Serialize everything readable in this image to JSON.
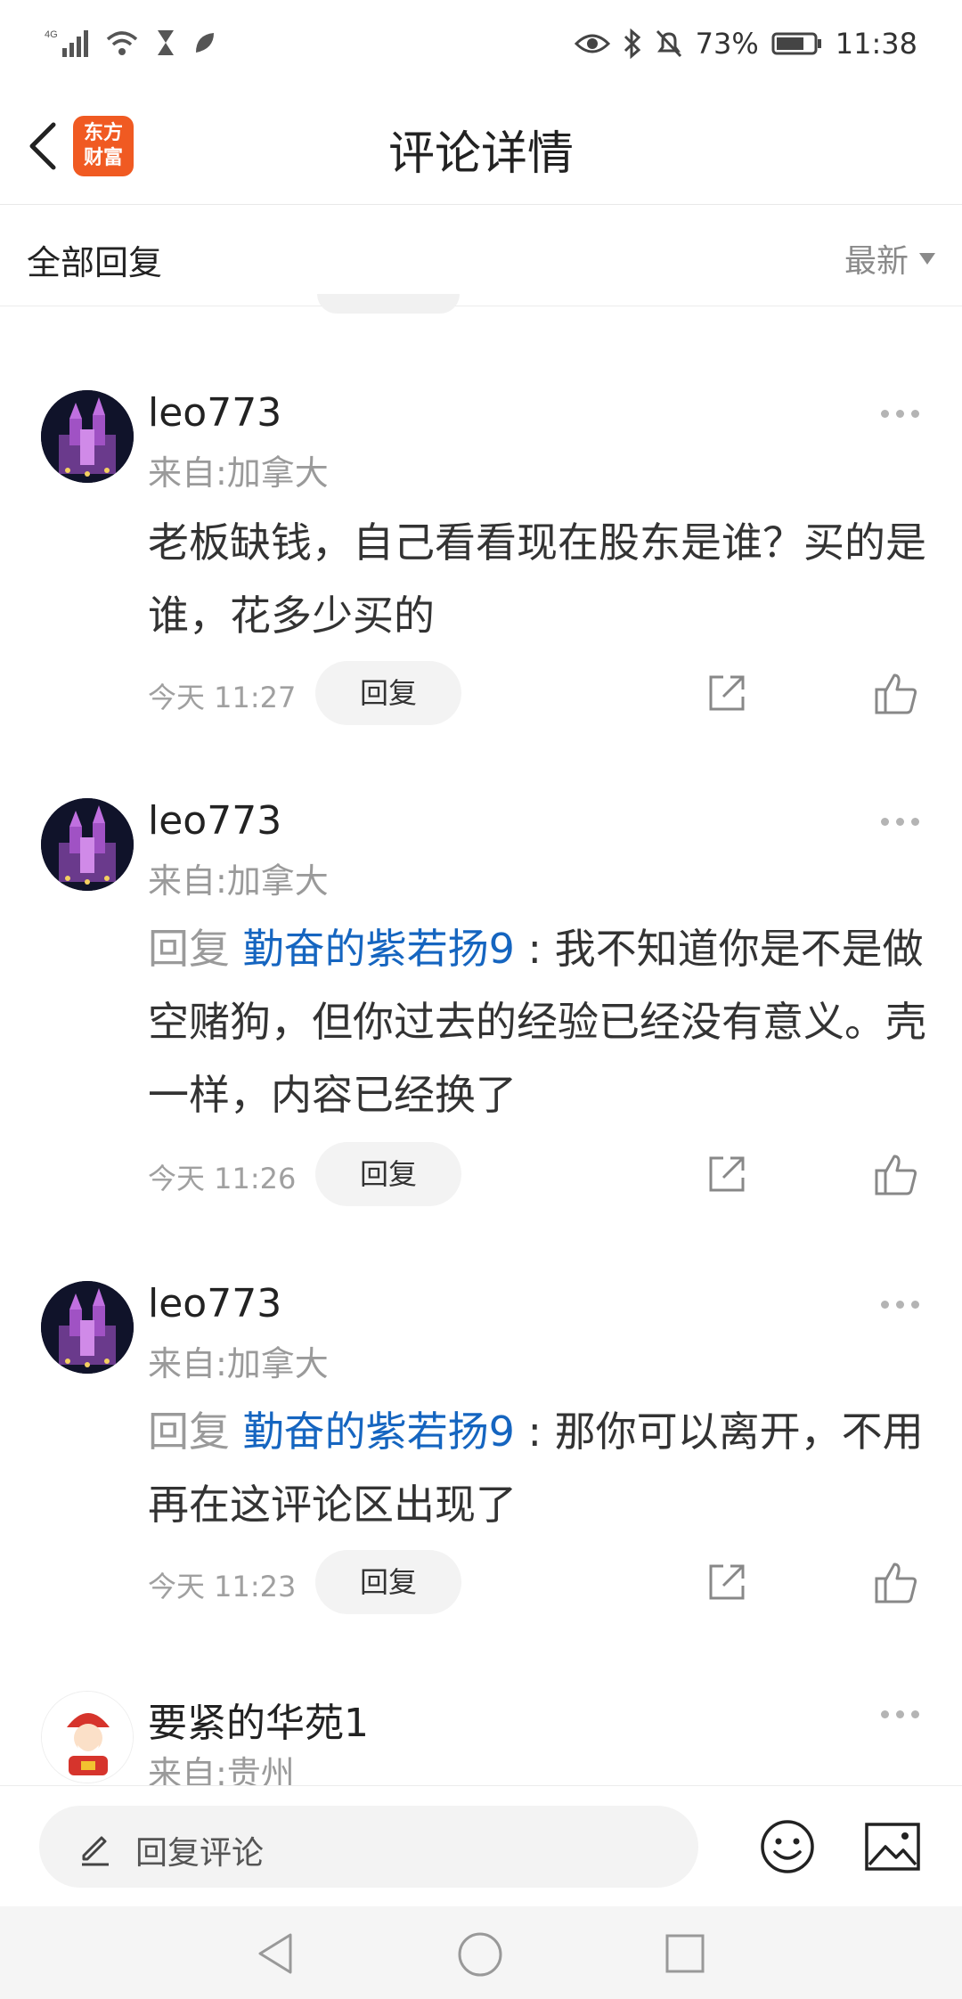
{
  "status_bar": {
    "network": "4G",
    "battery": "73%",
    "time": "11:38"
  },
  "header": {
    "title": "评论详情",
    "logo_text": "东方财富"
  },
  "subbar": {
    "all_replies": "全部回复",
    "sort": "最新"
  },
  "comments": [
    {
      "user": "leo773",
      "location": "来自:加拿大",
      "reply_prefix": "",
      "mention": "",
      "text": "老板缺钱，自己看看现在股东是谁？买的是谁，花多少买的",
      "time": "今天 11:27",
      "reply_label": "回复"
    },
    {
      "user": "leo773",
      "location": "来自:加拿大",
      "reply_prefix": "回复 ",
      "mention": "勤奋的紫若扬9",
      "text": " : 我不知道你是不是做空赌狗，但你过去的经验已经没有意义。壳一样，内容已经换了",
      "time": "今天 11:26",
      "reply_label": "回复"
    },
    {
      "user": "leo773",
      "location": "来自:加拿大",
      "reply_prefix": "回复 ",
      "mention": "勤奋的紫若扬9",
      "text": " : 那你可以离开，不用再在这评论区出现了",
      "time": "今天 11:23",
      "reply_label": "回复"
    },
    {
      "user": "要紧的华苑1",
      "location": "来自:贵州"
    }
  ],
  "bottom_bar": {
    "input_placeholder": "回复评论"
  },
  "colors": {
    "mention": "#1565c0",
    "logo": "#f05a22",
    "muted": "#9a9a9a"
  }
}
